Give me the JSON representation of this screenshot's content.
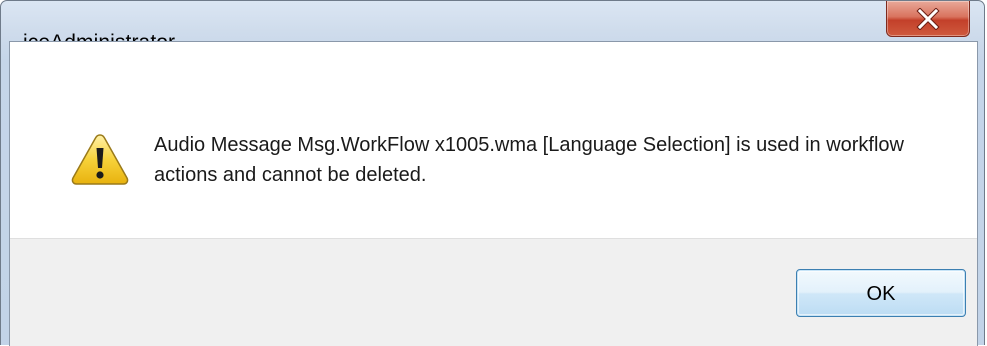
{
  "window": {
    "title": "iceAdministrator"
  },
  "title_bar": {
    "close_icon": "close-x-icon",
    "close_color": "#c8452e"
  },
  "dialog": {
    "icon": "warning-icon",
    "message": "Audio Message Msg.WorkFlow x1005.wma [Language Selection] is used in workflow actions and cannot be deleted.",
    "ok_label": "OK"
  },
  "colors": {
    "warning_fill": "#f7d23a",
    "warning_border": "#9a7a1a",
    "ok_button_border": "#3c7fb1"
  }
}
